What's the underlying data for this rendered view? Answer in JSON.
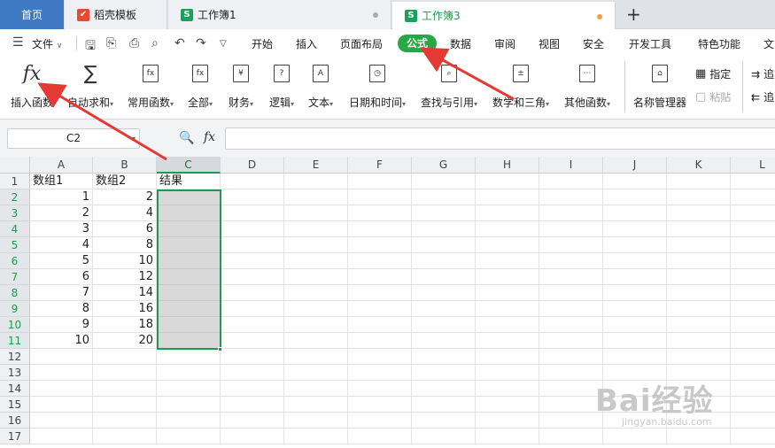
{
  "tabs": {
    "home": "首页",
    "template": "稻壳模板",
    "book1": "工作簿1",
    "book3": "工作簿3",
    "template_icon": "wps-logo-icon",
    "sheet_icon_letter": "S"
  },
  "menu": {
    "file": "文件",
    "items": [
      "开始",
      "插入",
      "页面布局",
      "公式",
      "数据",
      "审阅",
      "视图",
      "安全",
      "开发工具",
      "特色功能",
      "文"
    ],
    "active": "公式"
  },
  "ribbon": {
    "insert_func": "插入函数",
    "autosum": "自动求和",
    "common": "常用函数",
    "all": "全部",
    "finance": "财务",
    "logic": "逻辑",
    "text": "文本",
    "datetime": "日期和时间",
    "lookup": "查找与引用",
    "math": "数学和三角",
    "other": "其他函数",
    "name_mgr": "名称管理器",
    "specify": "指定",
    "paste": "粘贴",
    "trace1": "追",
    "trace2": "追"
  },
  "formula_bar": {
    "name_box": "C2",
    "fx": "fx"
  },
  "sheet": {
    "columns": [
      "A",
      "B",
      "C",
      "D",
      "E",
      "F",
      "G",
      "H",
      "I",
      "J",
      "K",
      "L"
    ],
    "rows": [
      "1",
      "2",
      "3",
      "4",
      "5",
      "6",
      "7",
      "8",
      "9",
      "10",
      "11",
      "12",
      "13",
      "14",
      "15",
      "16",
      "17"
    ],
    "header": [
      "数组1",
      "数组2",
      "结果"
    ],
    "data": [
      [
        "1",
        "2"
      ],
      [
        "2",
        "4"
      ],
      [
        "3",
        "6"
      ],
      [
        "4",
        "8"
      ],
      [
        "5",
        "10"
      ],
      [
        "6",
        "12"
      ],
      [
        "7",
        "14"
      ],
      [
        "8",
        "16"
      ],
      [
        "9",
        "18"
      ],
      [
        "10",
        "20"
      ]
    ],
    "selected_col": "C",
    "selected_range": "C2:C11"
  },
  "watermark": {
    "brand": "Bai经验",
    "url": "jingyan.baidu.com"
  },
  "colors": {
    "accent_green": "#1f9b4f",
    "menu_active": "#28a745",
    "tab_home": "#3f79c4",
    "arrow_red": "#e53935"
  }
}
